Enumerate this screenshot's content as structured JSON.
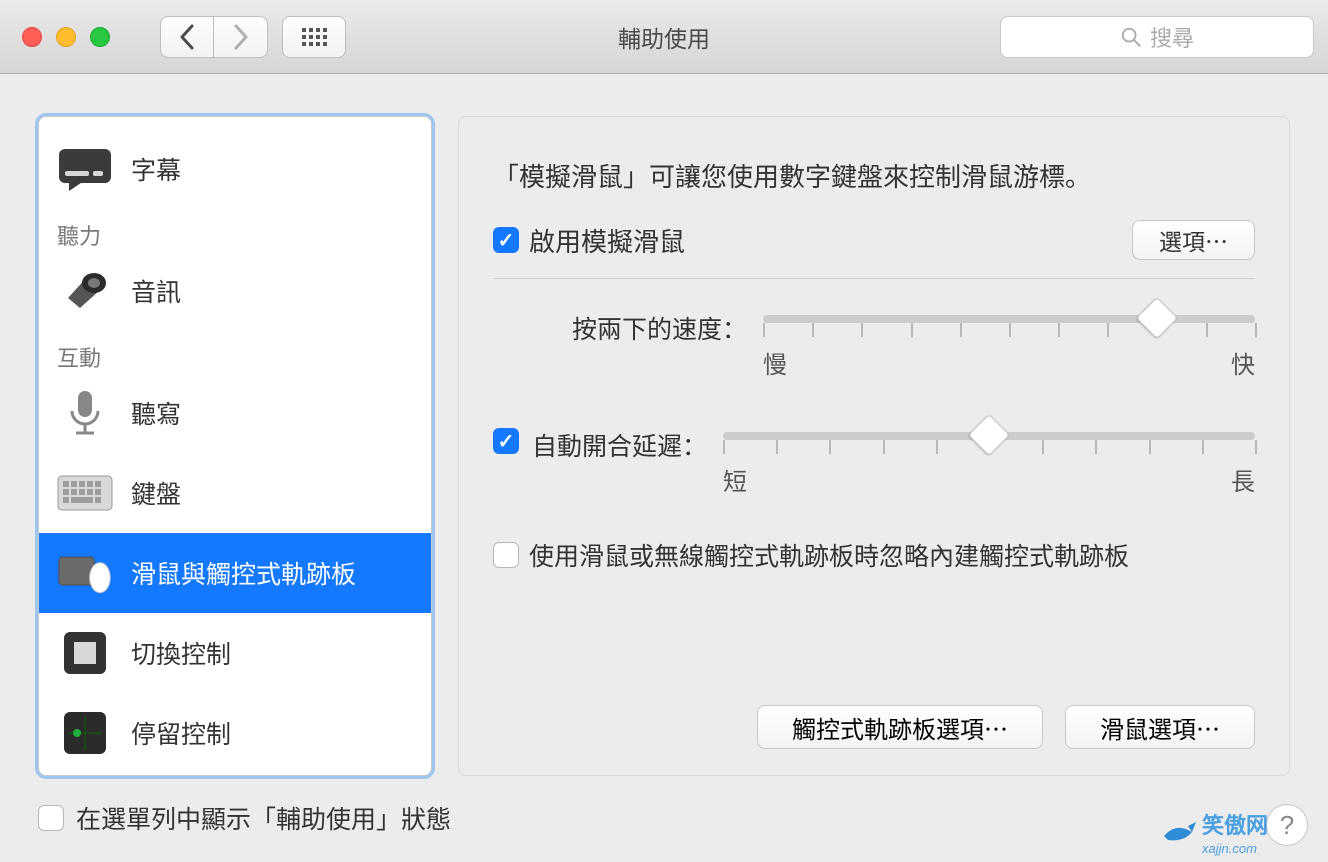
{
  "window": {
    "title": "輔助使用"
  },
  "search": {
    "placeholder": "搜尋"
  },
  "sidebar": {
    "header_hearing": "聽力",
    "header_interact": "互動",
    "items": {
      "subtitles": "字幕",
      "audio": "音訊",
      "dictation": "聽寫",
      "keyboard": "鍵盤",
      "mouse_trackpad": "滑鼠與觸控式軌跡板",
      "switch_control": "切換控制",
      "dwell_control": "停留控制"
    }
  },
  "panel": {
    "intro": "「模擬滑鼠」可讓您使用數字鍵盤來控制滑鼠游標。",
    "enable_label": "啟用模擬滑鼠",
    "options_btn": "選項⋯",
    "slider_dblclick": "按兩下的速度：",
    "slider_delay": "自動開合延遲：",
    "slow": "慢",
    "fast": "快",
    "short": "短",
    "long": "長",
    "ignore_trackpad": "使用滑鼠或無線觸控式軌跡板時忽略內建觸控式軌跡板",
    "trackpad_options_btn": "觸控式軌跡板選項⋯",
    "mouse_options_btn": "滑鼠選項⋯"
  },
  "footer": {
    "show_status": "在選單列中顯示「輔助使用」狀態"
  },
  "watermark": {
    "zh": "笑傲网",
    "url": "xajjn.com"
  }
}
